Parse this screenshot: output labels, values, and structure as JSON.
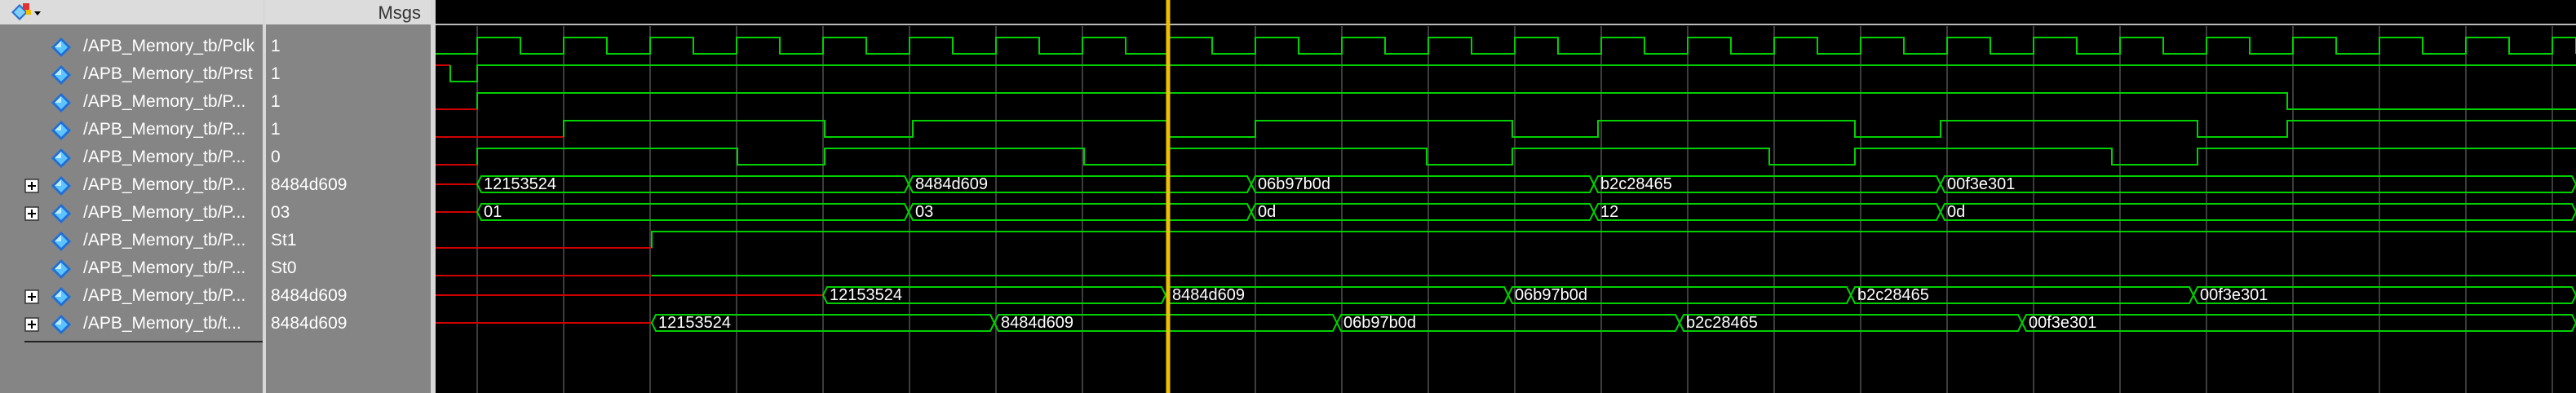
{
  "header": {
    "msgs_label": "Msgs"
  },
  "signals": [
    {
      "name": "/APB_Memory_tb/Pclk",
      "value": "1",
      "expandable": false
    },
    {
      "name": "/APB_Memory_tb/Prst",
      "value": "1",
      "expandable": false
    },
    {
      "name": "/APB_Memory_tb/P...",
      "value": "1",
      "expandable": false
    },
    {
      "name": "/APB_Memory_tb/P...",
      "value": "1",
      "expandable": false
    },
    {
      "name": "/APB_Memory_tb/P...",
      "value": "0",
      "expandable": false
    },
    {
      "name": "/APB_Memory_tb/P...",
      "value": "8484d609",
      "expandable": true
    },
    {
      "name": "/APB_Memory_tb/P...",
      "value": "03",
      "expandable": true
    },
    {
      "name": "/APB_Memory_tb/P...",
      "value": "St1",
      "expandable": false
    },
    {
      "name": "/APB_Memory_tb/P...",
      "value": "St0",
      "expandable": false
    },
    {
      "name": "/APB_Memory_tb/P...",
      "value": "8484d609",
      "expandable": true
    },
    {
      "name": "/APB_Memory_tb/t...",
      "value": "8484d609",
      "expandable": true
    }
  ],
  "bus_labels": {
    "row5": [
      "12153524",
      "8484d609",
      "06b97b0d",
      "b2c28465",
      "00f3e301"
    ],
    "row6": [
      "01",
      "03",
      "0d",
      "12",
      "0d"
    ],
    "row9": [
      "12153524",
      "8484d609",
      "06b97b0d",
      "b2c28465",
      "00f3e301"
    ],
    "row10": [
      "12153524",
      "8484d609",
      "06b97b0d",
      "b2c28465",
      "00f3e301"
    ]
  },
  "colors": {
    "panel_bg": "#858585",
    "wave_bg": "#000000",
    "signal_green": "#00d000",
    "undefined_red": "#d00000",
    "cursor_yellow": "#f0c000",
    "grid": "#505050"
  },
  "icons": {
    "signal": "diamond-signal-icon",
    "expand": "plus-box-icon",
    "toolbar": "wave-tool-icon"
  }
}
